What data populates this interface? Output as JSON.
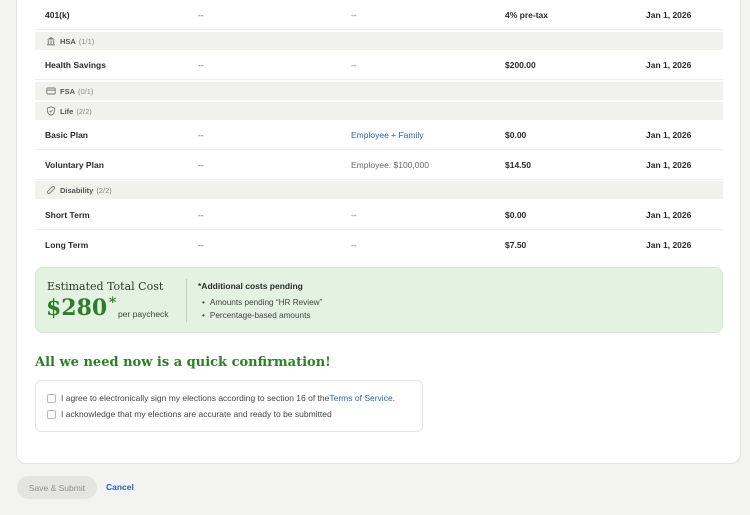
{
  "rows_top": [
    {
      "name": "401(k)",
      "col2": "--",
      "col3": "--",
      "cost": "4% pre-tax",
      "date": "Jan 1, 2026"
    }
  ],
  "groups": {
    "hsa": {
      "icon": "bank-icon",
      "name": "HSA",
      "count": "(1/1)"
    },
    "fsa": {
      "icon": "card-icon",
      "name": "FSA",
      "count": "(0/1)"
    },
    "life": {
      "icon": "shield-icon",
      "name": "Life",
      "count": "(2/2)"
    },
    "disability": {
      "icon": "bandage-icon",
      "name": "Disability",
      "count": "(2/2)"
    }
  },
  "hsa_rows": [
    {
      "name": "Health Savings",
      "col2": "--",
      "col3": "--",
      "cost": "$200.00",
      "date": "Jan 1, 2026"
    }
  ],
  "life_rows": [
    {
      "name": "Basic Plan",
      "col2": "--",
      "col3": "Employee + Family",
      "cost": "$0.00",
      "date": "Jan 1, 2026"
    },
    {
      "name": "Voluntary Plan",
      "col2": "--",
      "col3": "Employee: $100,000",
      "cost": "$14.50",
      "date": "Jan 1, 2026"
    }
  ],
  "disability_rows": [
    {
      "name": "Short Term",
      "col2": "--",
      "col3": "--",
      "cost": "$0.00",
      "date": "Jan 1, 2026"
    },
    {
      "name": "Long Term",
      "col2": "--",
      "col3": "--",
      "cost": "$7.50",
      "date": "Jan 1, 2026"
    }
  ],
  "estimate": {
    "title": "Estimated Total Cost",
    "amount": "$280",
    "star": "*",
    "per": "per paycheck",
    "pending_title": "*Additional costs pending",
    "pending_items": [
      "Amounts pending “HR Review”",
      "Percentage-based amounts"
    ]
  },
  "confirm": {
    "heading": "All we need now is a quick confirmation!",
    "agree_prefix": "I agree to electronically sign my elections according to section 16 of the ",
    "agree_link": "Terms of Service",
    "agree_suffix": ".",
    "acknowledge": "I acknowledge that my elections are accurate and ready to be submitted"
  },
  "actions": {
    "save_label": "Save & Submit",
    "cancel_label": "Cancel"
  },
  "colors": {
    "accent_green": "#2f7d2a",
    "link_blue": "#2a63b8",
    "estimate_bg": "#e3f2e1"
  }
}
